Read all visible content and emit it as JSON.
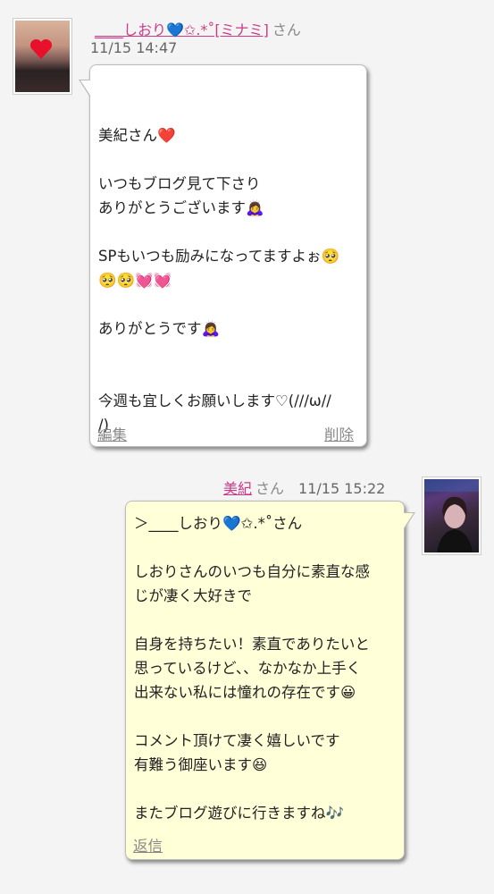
{
  "post1": {
    "author_name": "____しおり💙✩.*˚[ミナミ]",
    "honorific": "さん",
    "timestamp": "11/15 14:47",
    "lines": [
      "",
      "美紀さん❤️",
      "",
      "いつもブログ見て下さり",
      "ありがとうございます🙇‍♀️",
      "",
      "SPもいつも励みになってますよぉ🥺",
      "🥺🥺💓💓",
      "",
      "ありがとうです🙇‍♀️",
      "",
      "",
      "今週も宜しくお願いします♡(///ω//",
      "/)"
    ],
    "edit_label": "編集",
    "delete_label": "削除"
  },
  "post2": {
    "author_name": "美紀",
    "honorific": "さん",
    "timestamp": "11/15 15:22",
    "lines": [
      "＞____しおり💙✩.*˚さん",
      "",
      "しおりさんのいつも自分に素直な感",
      "じが凄く大好きで",
      "",
      "自身を持ちたい！素直でありたいと",
      "思っているけど、、なかなか上手く",
      "出来ない私には憧れの存在です😀",
      "",
      "コメント頂けて凄く嬉しいです",
      "有難う御座います😆",
      "",
      "またブログ遊びに行きますね🎶"
    ],
    "reply_label": "返信"
  },
  "colors": {
    "name_link": "#cc3a86",
    "reply_bubble": "#ffffd8"
  }
}
